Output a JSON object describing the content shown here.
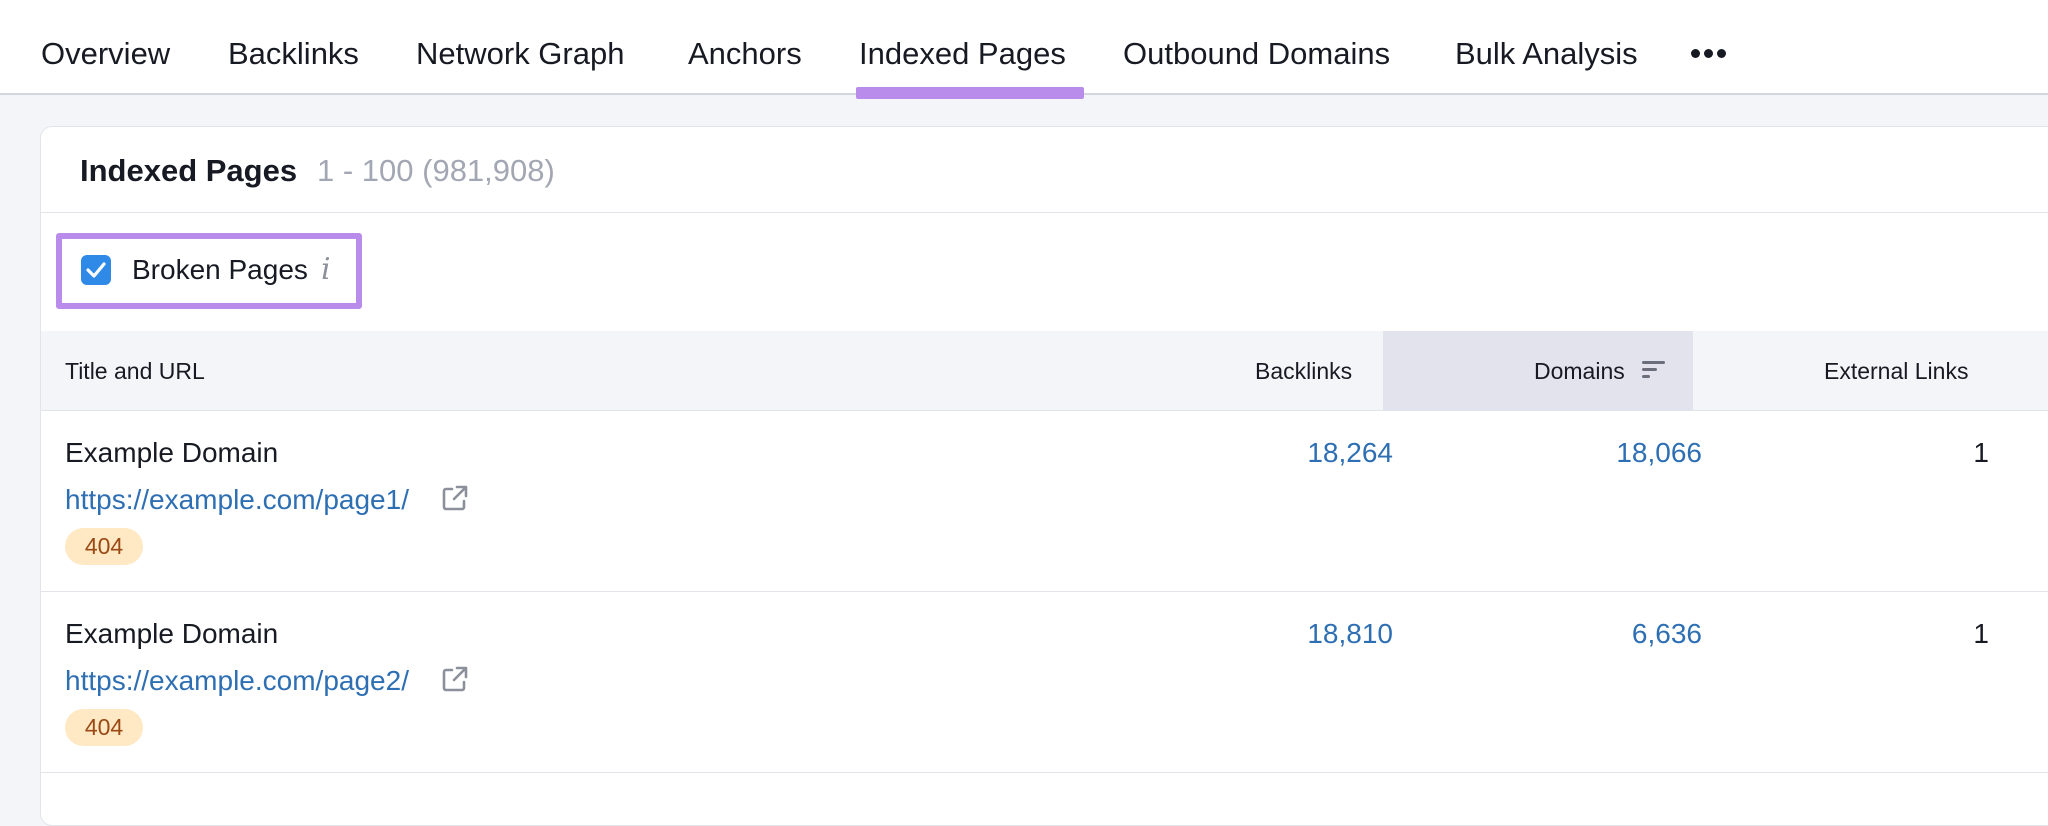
{
  "tabs": [
    {
      "label": "Overview"
    },
    {
      "label": "Backlinks"
    },
    {
      "label": "Network Graph"
    },
    {
      "label": "Anchors"
    },
    {
      "label": "Indexed Pages",
      "active": true
    },
    {
      "label": "Outbound Domains"
    },
    {
      "label": "Bulk Analysis"
    }
  ],
  "more_icon": "ellipsis-icon",
  "card": {
    "title": "Indexed Pages",
    "range": "1 - 100 (981,908)"
  },
  "filter": {
    "label": "Broken Pages",
    "checked": true,
    "info_icon": "i"
  },
  "table": {
    "columns": {
      "title_url": "Title and URL",
      "backlinks": "Backlinks",
      "domains": "Domains",
      "external_links": "External Links"
    },
    "rows": [
      {
        "title": "Example Domain",
        "url": "https://example.com/page1/",
        "status": "404",
        "backlinks": "18,264",
        "domains": "18,066",
        "external_links": "1"
      },
      {
        "title": "Example Domain",
        "url": "https://example.com/page2/",
        "status": "404",
        "backlinks": "18,810",
        "domains": "6,636",
        "external_links": "1"
      }
    ]
  },
  "colors": {
    "accent_highlight": "#b98ceb",
    "link": "#2e6fb3",
    "checkbox": "#2e8ae6",
    "badge_bg": "#ffe8c4",
    "badge_text": "#9a4a14"
  }
}
